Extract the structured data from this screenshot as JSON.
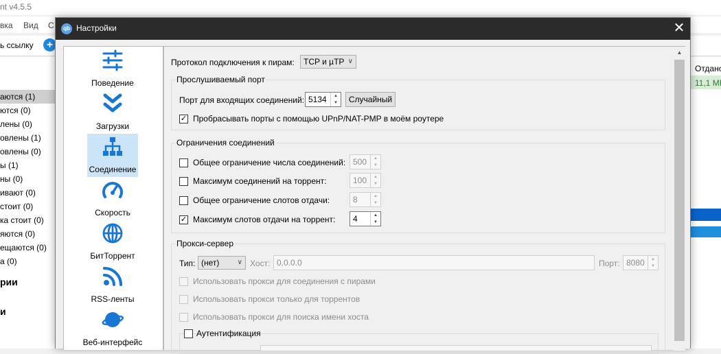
{
  "background": {
    "title": "nt v4.5.5",
    "menu": [
      "вка",
      "Вид",
      "С"
    ],
    "toolbar_text": "ь ссылку",
    "add_icon": "plus-icon",
    "filters": [
      {
        "label": "аются (1)",
        "selected": true
      },
      {
        "label": "ются (0)",
        "selected": false
      },
      {
        "label": "лены (0)",
        "selected": false
      },
      {
        "label": "овлены (1)",
        "selected": false
      },
      {
        "label": "овлены (0)",
        "selected": false
      },
      {
        "label": "ы (1)",
        "selected": false
      },
      {
        "label": "ны (0)",
        "selected": false
      },
      {
        "label": "ивают (0)",
        "selected": false
      },
      {
        "label": "стоит (0)",
        "selected": false
      },
      {
        "label": "ка стоит (0)",
        "selected": false
      },
      {
        "label": "яются (0)",
        "selected": false
      },
      {
        "label": "ещаются (0)",
        "selected": false
      },
      {
        "label": "а (0)",
        "selected": false
      }
    ],
    "section1": "рии",
    "section2": "и",
    "column_header": "Отдано",
    "column_value": "11,1 МБ"
  },
  "dialog": {
    "title": "Настройки",
    "icon": "qbittorrent-icon",
    "close_icon": "close-icon",
    "categories": [
      {
        "label": "Поведение",
        "icon": "sliders-icon",
        "selected": false
      },
      {
        "label": "Загрузки",
        "icon": "double-chevron-down-icon",
        "selected": false
      },
      {
        "label": "Соединение",
        "icon": "network-icon",
        "selected": true
      },
      {
        "label": "Скорость",
        "icon": "speedometer-icon",
        "selected": false
      },
      {
        "label": "БитТоррент",
        "icon": "globe-icon",
        "selected": false
      },
      {
        "label": "RSS-ленты",
        "icon": "rss-icon",
        "selected": false
      },
      {
        "label": "Веб-интерфейс",
        "icon": "planet-icon",
        "selected": false
      }
    ],
    "connection": {
      "protocol_label": "Протокол подключения к пирам:",
      "protocol_value": "TCP и µTP",
      "listen_group": {
        "title": "Прослушиваемый порт",
        "port_label": "Порт для входящих соединений:",
        "port_value": "5134",
        "random_button": "Случайный",
        "upnp_label": "Пробрасывать порты с помощью UPnP/NAT-PMP в моём роутере",
        "upnp_checked": true
      },
      "limits_group": {
        "title": "Ограничения соединений",
        "rows": [
          {
            "label": "Общее ограничение числа соединений:",
            "value": "500",
            "checked": false
          },
          {
            "label": "Максимум соединений на торрент:",
            "value": "100",
            "checked": false
          },
          {
            "label": "Общее ограничение слотов отдачи:",
            "value": "8",
            "checked": false
          },
          {
            "label": "Максимум слотов отдачи на торрент:",
            "value": "4",
            "checked": true
          }
        ]
      },
      "proxy_group": {
        "title": "Прокси-сервер",
        "type_label": "Тип:",
        "type_value": "(нет)",
        "host_label": "Хост:",
        "host_placeholder": "0.0.0.0",
        "port_label": "Порт:",
        "port_value": "8080",
        "options": [
          "Использовать прокси для соединения с пирами",
          "Использовать прокси только для торрентов",
          "Использовать прокси для поиска имени хоста"
        ],
        "auth_label": "Аутентификация"
      }
    }
  }
}
